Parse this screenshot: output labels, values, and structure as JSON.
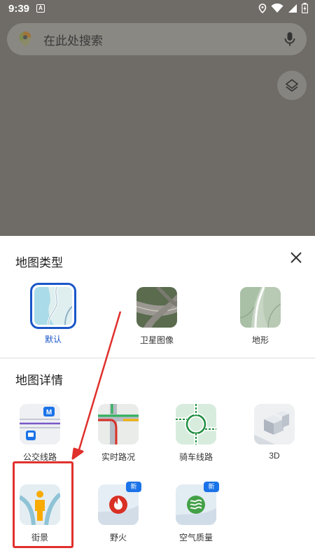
{
  "status": {
    "time": "9:39",
    "notif": "A"
  },
  "search": {
    "placeholder": "在此处搜索"
  },
  "sheet": {
    "map_type_title": "地图类型",
    "map_detail_title": "地图详情",
    "map_types": [
      {
        "label": "默认",
        "selected": true
      },
      {
        "label": "卫星图像",
        "selected": false
      },
      {
        "label": "地形",
        "selected": false
      }
    ],
    "map_details": [
      {
        "label": "公交线路"
      },
      {
        "label": "实时路况"
      },
      {
        "label": "骑车线路"
      },
      {
        "label": "3D"
      },
      {
        "label": "街景"
      },
      {
        "label": "野火",
        "badge": "新"
      },
      {
        "label": "空气质量",
        "badge": "新"
      }
    ]
  },
  "colors": {
    "accent": "#1a56c9",
    "highlight": "#e0302c"
  }
}
